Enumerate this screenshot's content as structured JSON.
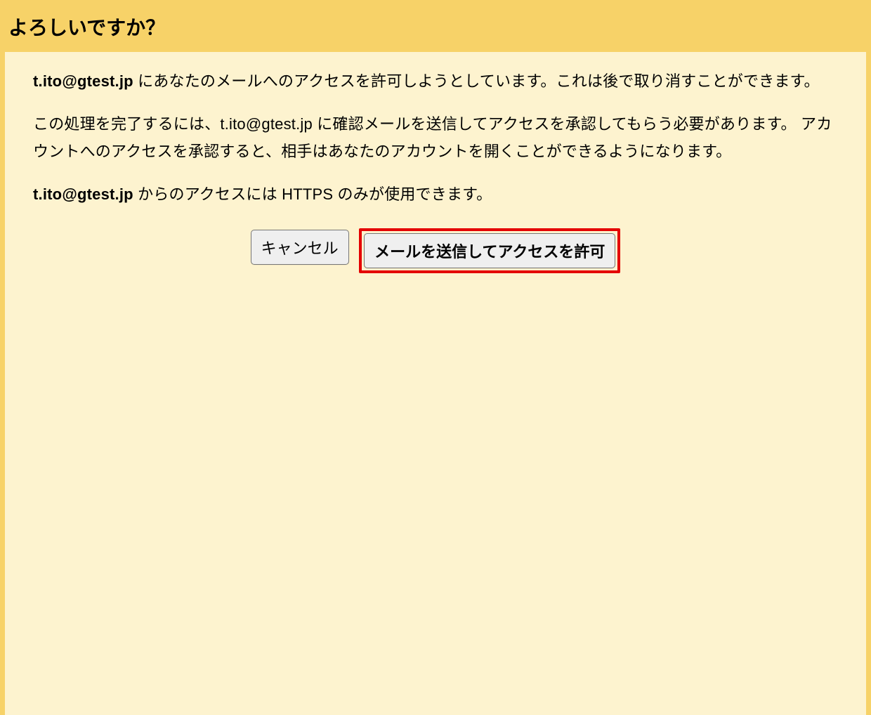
{
  "header": {
    "title": "よろしいですか？"
  },
  "body": {
    "email": "t.ito@gtest.jp",
    "p1_bold": "t.ito@gtest.jp",
    "p1_rest": " にあなたのメールへのアクセスを許可しようとしています。これは後で取り消すことができます。",
    "p2": "この処理を完了するには、t.ito@gtest.jp に確認メールを送信してアクセスを承認してもらう必要があります。 アカウントへのアクセスを承認すると、相手はあなたのアカウントを開くことができるようになります。",
    "p3_bold": "t.ito@gtest.jp",
    "p3_rest": " からのアクセスには HTTPS のみが使用できます。"
  },
  "buttons": {
    "cancel": "キャンセル",
    "confirm": "メールを送信してアクセスを許可"
  },
  "colors": {
    "headerBg": "#f7d268",
    "contentBg": "#fdf3cf",
    "highlight": "#e40000"
  }
}
